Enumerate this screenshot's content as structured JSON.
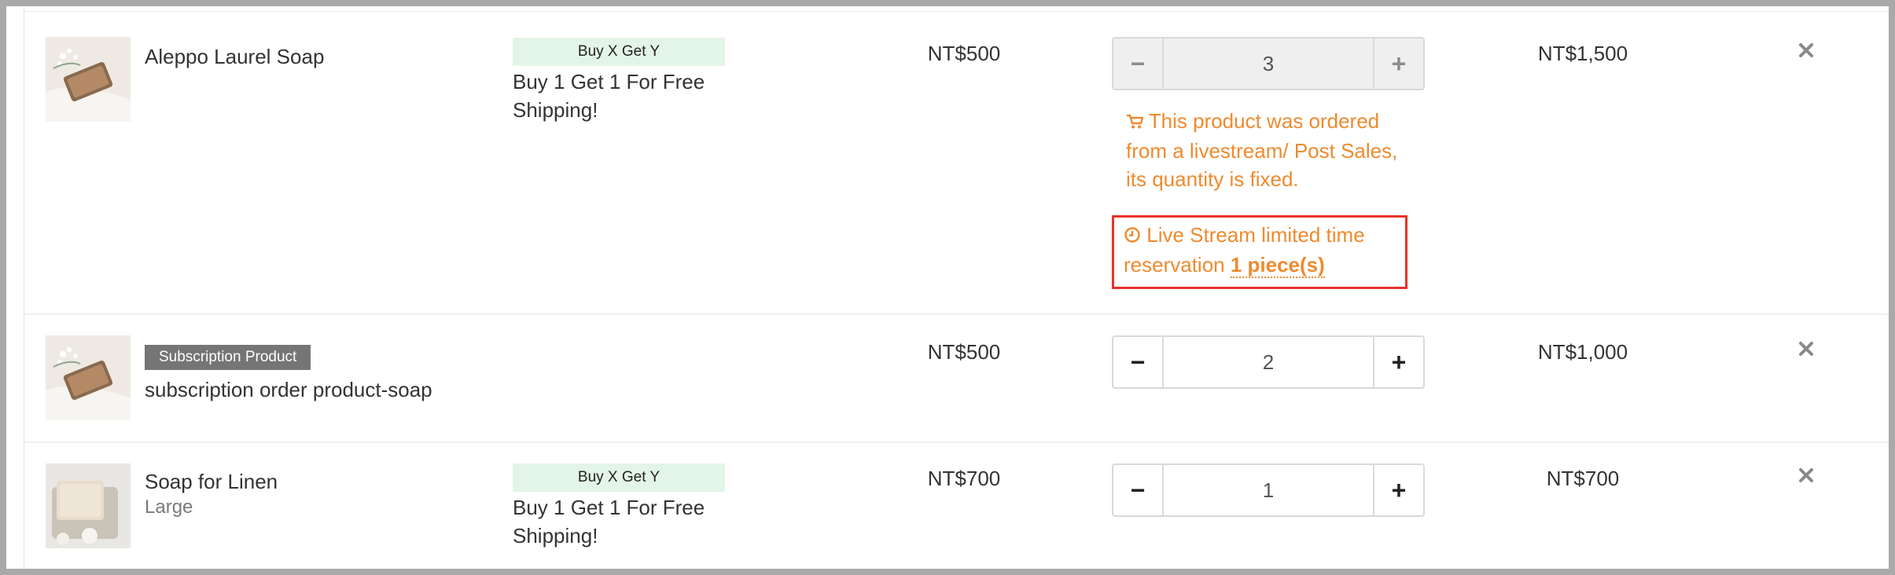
{
  "colors": {
    "accent_orange": "#ef8a2e",
    "alert_red": "#e8332a",
    "promo_bg": "#e3f5e6",
    "badge_gray": "#757575"
  },
  "items": [
    {
      "name": "Aleppo Laurel Soap",
      "promo_badge": "Buy X Get Y",
      "promo_text": "Buy 1 Get 1 For Free Shipping!",
      "price": "NT$500",
      "quantity": "3",
      "quantity_locked": true,
      "subtotal": "NT$1,500",
      "notice_icon": "cart-icon",
      "notice": "This product was ordered from a livestream/ Post Sales, its quantity is fixed.",
      "limited_icon": "clock-icon",
      "limited_text": "Live Stream limited time reservation ",
      "limited_qty": "1 piece(s)"
    },
    {
      "name": "subscription order product-soap",
      "badge": "Subscription Product",
      "price": "NT$500",
      "quantity": "2",
      "subtotal": "NT$1,000"
    },
    {
      "name": "Soap for Linen",
      "variant": "Large",
      "promo_badge": "Buy X Get Y",
      "promo_text": "Buy 1 Get 1 For Free Shipping!",
      "price": "NT$700",
      "quantity": "1",
      "subtotal": "NT$700"
    }
  ],
  "icons": {
    "minus": "−",
    "plus": "+",
    "remove": "close-icon"
  }
}
